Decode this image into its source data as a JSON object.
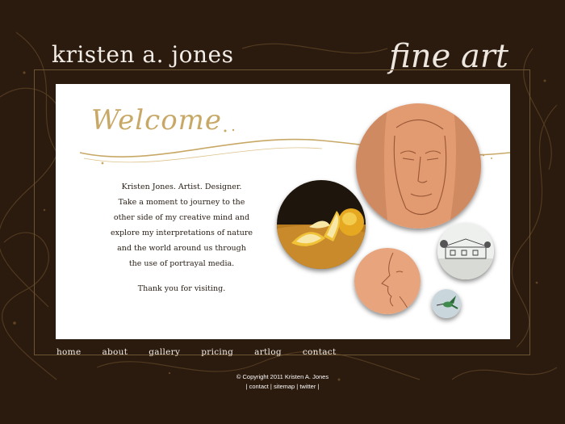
{
  "header": {
    "site_name": "kristen a. jones",
    "tagline": "fine art"
  },
  "welcome": {
    "title": "Welcome",
    "intro_lines": [
      "Kristen Jones. Artist. Designer.",
      "Take a moment to journey to the",
      "other side of my creative mind and",
      "explore my interpretations of nature",
      "and the world around us through",
      "the use of portrayal media."
    ],
    "thanks": "Thank you for visiting."
  },
  "gallery_thumbnails": [
    {
      "subject": "lemons-painting"
    },
    {
      "subject": "face-portrait-sketch"
    },
    {
      "subject": "house-sketch"
    },
    {
      "subject": "profile-sketch"
    },
    {
      "subject": "hummingbird"
    }
  ],
  "nav": {
    "items": [
      {
        "label": "home"
      },
      {
        "label": "about"
      },
      {
        "label": "gallery"
      },
      {
        "label": "pricing"
      },
      {
        "label": "artlog"
      },
      {
        "label": "contact"
      }
    ]
  },
  "footer": {
    "copyright": "© Copyright 2011 Kristen A. Jones",
    "links": [
      {
        "label": "contact"
      },
      {
        "label": "sitemap"
      },
      {
        "label": "twitter"
      }
    ]
  },
  "colors": {
    "background": "#2b1a0e",
    "gold_accent": "#c8a866",
    "panel": "#ffffff",
    "text_light": "#f2ede6"
  }
}
